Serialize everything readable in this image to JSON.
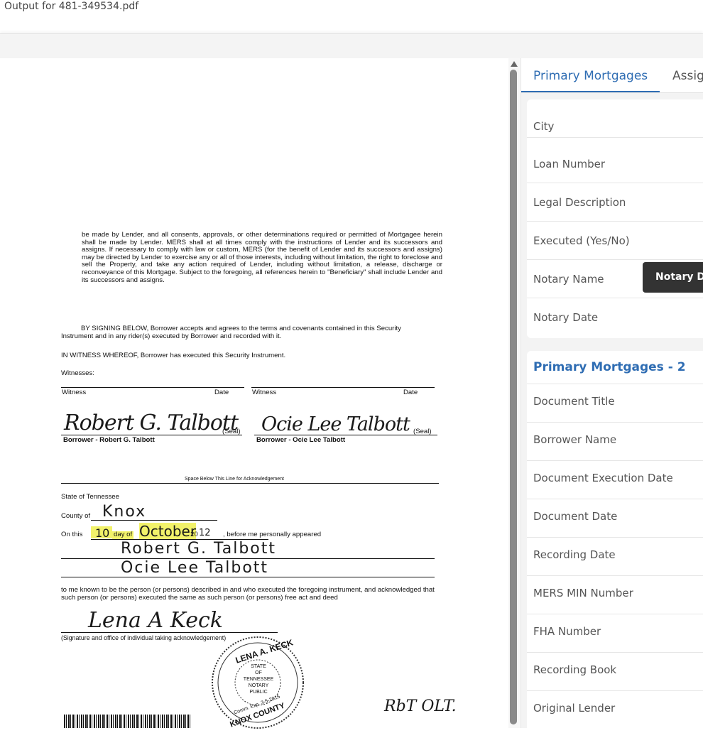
{
  "window": {
    "title": "Output for 481-349534.pdf"
  },
  "document": {
    "paragraph1": "be made by Lender, and all consents, approvals, or other determinations required or permitted of Mortgagee herein shall be made by Lender. MERS shall at all times comply with the instructions of Lender and its successors and assigns. If necessary to comply with law or custom, MERS (for the benefit of Lender and its successors and assigns) may be directed by Lender to exercise any or all of those interests, including without limitation, the right to foreclose and sell the Property, and take any action required of Lender, including without limitation, a release, discharge or reconveyance of this Mortgage. Subject to the foregoing, all references herein to \"Beneficiary\" shall include Lender and its successors and assigns.",
    "paragraph2": "BY SIGNING BELOW, Borrower accepts and agrees to the terms and covenants contained in this Security Instrument and in any rider(s) executed by Borrower and recorded with it.",
    "witness_clause": "IN WITNESS WHEREOF, Borrower has executed this Security Instrument.",
    "witnesses_label": "Witnesses:",
    "witness_label": "Witness",
    "date_label": "Date",
    "seal_label": "(Seal)",
    "borrower1_label": "Borrower - Robert G. Talbott",
    "borrower2_label": "Borrower - Ocie Lee Talbott",
    "signature1": "Robert G. Talbott",
    "signature2": "Ocie Lee Talbott",
    "ack_line": "Space Below This Line for Acknowledgement",
    "state_line": "State of Tennessee",
    "county_label": "County of",
    "county_value": "Knox",
    "on_this": "On this",
    "day_value": "10",
    "day_of": "day of",
    "month_value": "October",
    "year_prefix": "20",
    "year_value": "12",
    "appeared": ", before me personally appeared",
    "appeared_name1": "Robert G. Talbott",
    "appeared_name2": "Ocie Lee Talbott",
    "known_text": "to me known to be the person (or persons) described in and who executed the foregoing instrument, and acknowledged that such person (or persons) executed the same as such person (or persons) free act and deed",
    "notary_signature": "Lena A Keck",
    "notary_caption": "(Signature and office of individual taking acknowledgement)",
    "seal": {
      "name": "LENA A. KECK",
      "state": "STATE",
      "of": "OF",
      "state_name": "TENNESSEE",
      "notary": "NOTARY",
      "public": "PUBLIC",
      "expiry": "Comm. Exp. 3-5-2015",
      "county": "KNOX COUNTY"
    },
    "initials": "RbT OLT."
  },
  "panel": {
    "tabs": [
      {
        "label": "Primary Mortgages"
      },
      {
        "label": "Assig"
      }
    ],
    "card1_fields": [
      {
        "label": "City"
      },
      {
        "label": "Loan Number"
      },
      {
        "label": "Legal Description"
      },
      {
        "label": "Executed (Yes/No)"
      },
      {
        "label": "Notary Name"
      },
      {
        "label": "Notary Date"
      }
    ],
    "tooltip": "Notary Da",
    "card2_title": "Primary Mortgages - 2",
    "card2_fields": [
      {
        "label": "Document Title"
      },
      {
        "label": "Borrower Name"
      },
      {
        "label": "Document Execution Date"
      },
      {
        "label": "Document Date"
      },
      {
        "label": "Recording Date"
      },
      {
        "label": "MERS MIN Number"
      },
      {
        "label": "FHA Number"
      },
      {
        "label": "Recording Book"
      },
      {
        "label": "Original Lender"
      }
    ]
  },
  "colors": {
    "accent": "#2f6db3",
    "highlight": "#f2f26a",
    "tooltip_bg": "#333333"
  }
}
